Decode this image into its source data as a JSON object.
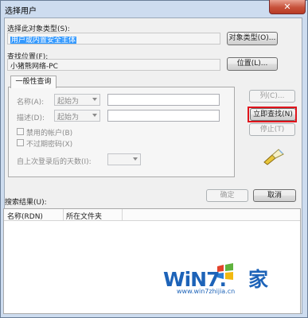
{
  "window": {
    "title": "选择用户",
    "close_symbol": "✕"
  },
  "object_type": {
    "label": "选择此对象类型(S):",
    "value": "用户或内置安全主体",
    "button": "对象类型(O)..."
  },
  "location": {
    "label": "查找位置(F):",
    "value": "小猪熊网络-PC",
    "button": "位置(L)..."
  },
  "tab": {
    "label": "一般性查询"
  },
  "query": {
    "name_label": "名称(A):",
    "name_mode": "起始为",
    "desc_label": "描述(D):",
    "desc_mode": "起始为",
    "disabled_accounts": "禁用的帐户(B)",
    "non_expiring_password": "不过期密码(X)",
    "days_since_logon": "自上次登录后的天数(I):"
  },
  "side_buttons": {
    "columns": "列(C)...",
    "find_now": "立即查找(N)",
    "stop": "停止(T)"
  },
  "results": {
    "label": "搜索结果(U):",
    "ok": "确定",
    "cancel": "取消",
    "columns": [
      "名称(RDN)",
      "所在文件夹"
    ]
  },
  "watermark": {
    "brand_a": "WiN7.",
    "brand_b": "家",
    "url": "www.win7zhijia.cn"
  },
  "colors": {
    "highlight_border": "#e0141c",
    "selection": "#3399ff",
    "brand": "#1d63b8"
  }
}
